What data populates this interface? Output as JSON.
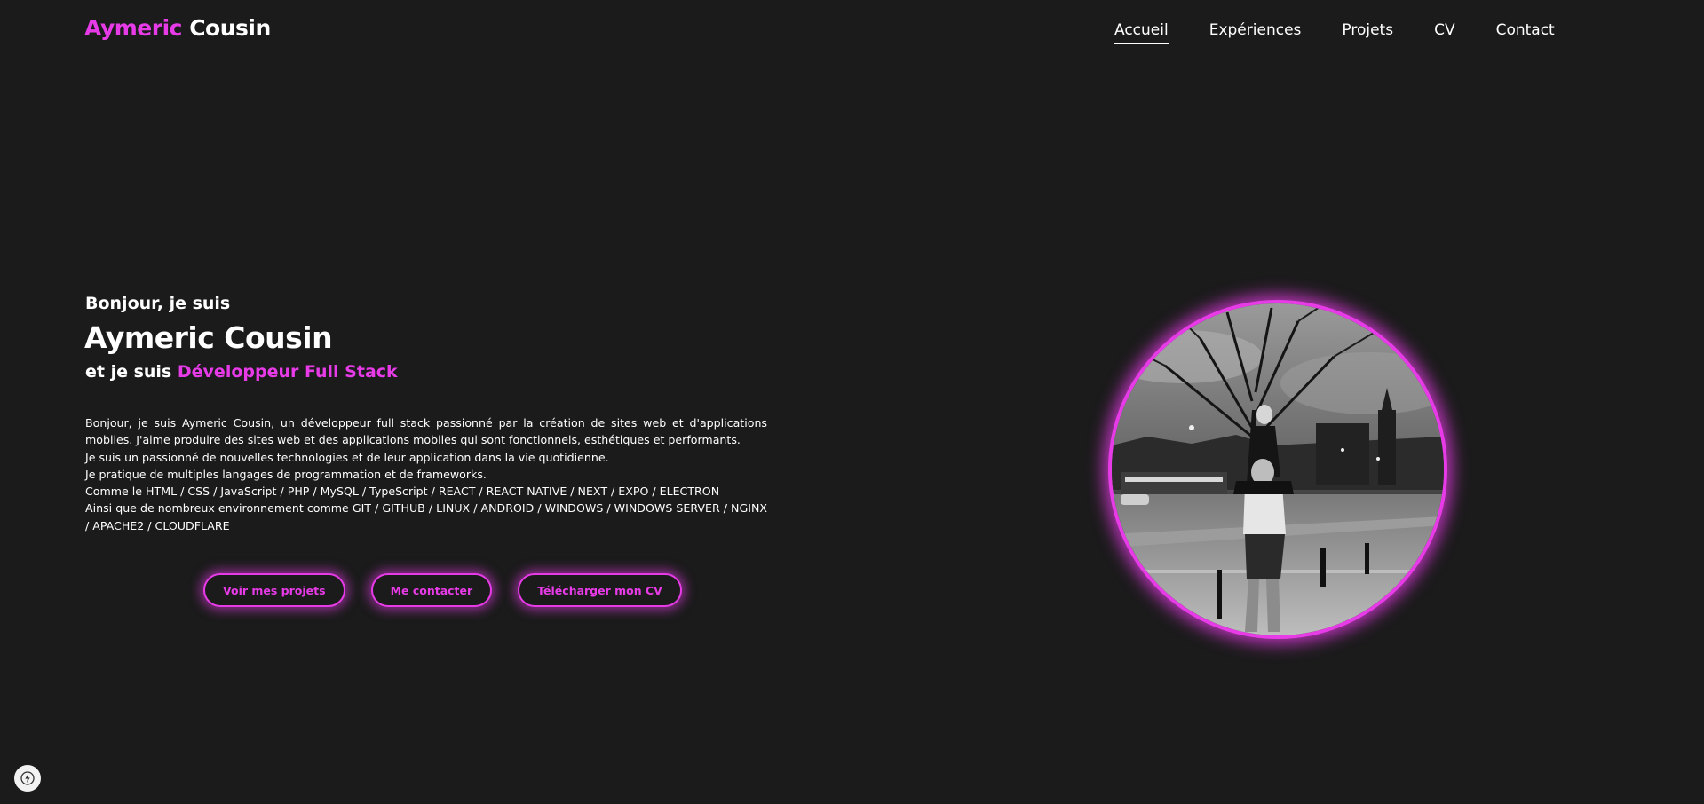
{
  "header": {
    "logo_first": "Aymeric",
    "logo_last": "Cousin",
    "nav": [
      {
        "label": "Accueil",
        "active": true
      },
      {
        "label": "Expériences",
        "active": false
      },
      {
        "label": "Projets",
        "active": false
      },
      {
        "label": "CV",
        "active": false
      },
      {
        "label": "Contact",
        "active": false
      }
    ]
  },
  "hero": {
    "greeting": "Bonjour, je suis",
    "name": "Aymeric Cousin",
    "role_prefix": "et je suis",
    "role": "Développeur Full Stack",
    "bio": {
      "line1": "Bonjour, je suis Aymeric Cousin, un développeur full stack passionné par la création de sites web et d'applications mobiles. J'aime produire des sites web et des applications mobiles qui sont fonctionnels, esthétiques et performants.",
      "line2": "Je suis un passionné de nouvelles technologies et de leur application dans la vie quotidienne.",
      "line3": "Je pratique de multiples langages de programmation et de frameworks.",
      "line4": "Comme le HTML / CSS / JavaScript / PHP / MySQL / TypeScript / REACT / REACT NATIVE / NEXT / EXPO / ELECTRON",
      "line5": "Ainsi que de nombreux environnement comme GIT / GITHUB / LINUX / ANDROID / WINDOWS / WINDOWS SERVER / NGINX / APACHE2 / CLOUDFLARE"
    },
    "buttons": {
      "projects": "Voir mes projets",
      "contact": "Me contacter",
      "cv": "Télécharger mon CV"
    }
  },
  "avatar": {
    "icon": "profile-photo",
    "style": "black-and-white photo, round frame"
  },
  "badge": {
    "icon": "lightning-icon"
  },
  "colors": {
    "background": "#1b1b1b",
    "accent": "#e83be8",
    "text": "#ffffff"
  }
}
